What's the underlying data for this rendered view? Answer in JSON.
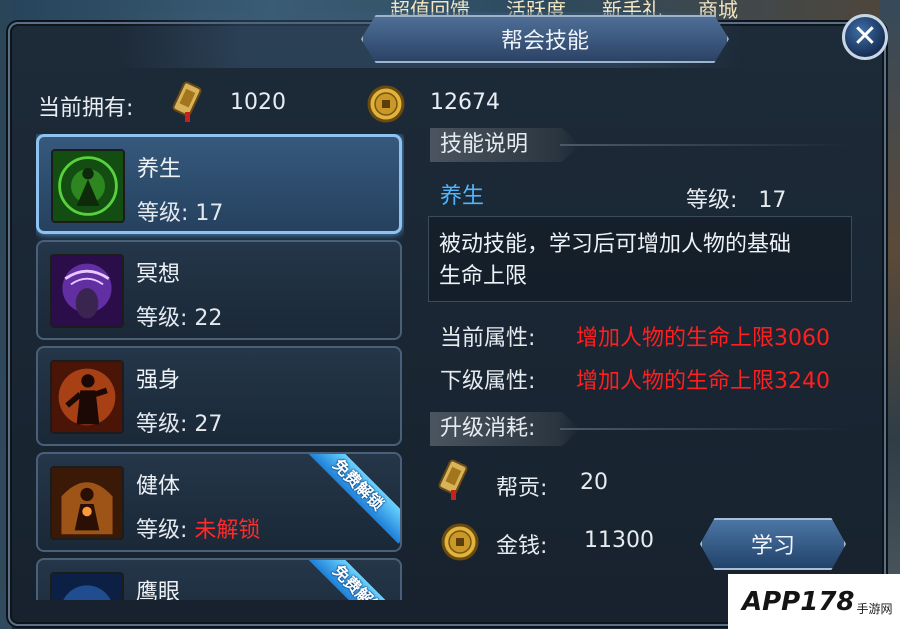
{
  "background": {
    "top_tabs": [
      "超值回馈",
      "活跃度",
      "新手礼",
      "商城"
    ]
  },
  "panel": {
    "title": "帮会技能",
    "close_icon": "close-icon"
  },
  "owned": {
    "label": "当前拥有:",
    "contribution": "1020",
    "gold": "12674"
  },
  "skills": [
    {
      "name": "养生",
      "level_label": "等级:",
      "level": "17",
      "locked": false,
      "selected": true,
      "ribbon": "",
      "icon": "meditation-icon",
      "color": "#3fae2a"
    },
    {
      "name": "冥想",
      "level_label": "等级:",
      "level": "22",
      "locked": false,
      "selected": false,
      "ribbon": "",
      "icon": "mind-icon",
      "color": "#7b3fc7"
    },
    {
      "name": "强身",
      "level_label": "等级:",
      "level": "27",
      "locked": false,
      "selected": false,
      "ribbon": "",
      "icon": "strength-icon",
      "color": "#d0531d"
    },
    {
      "name": "健体",
      "level_label": "等级:",
      "level": "未解锁",
      "locked": true,
      "selected": false,
      "ribbon": "免费解锁",
      "icon": "body-icon",
      "color": "#b8631a"
    },
    {
      "name": "鹰眼",
      "level_label": "",
      "level": "",
      "locked": true,
      "selected": false,
      "ribbon": "免费解锁",
      "icon": "eye-icon",
      "color": "#2a5fb0"
    }
  ],
  "details": {
    "desc_header": "技能说明",
    "skill_name": "养生",
    "level_label": "等级:",
    "level": "17",
    "description_line1": "被动技能，学习后可增加人物的基础",
    "description_line2": "生命上限",
    "current_attr_label": "当前属性:",
    "current_attr_value": "增加人物的生命上限3060",
    "next_attr_label": "下级属性:",
    "next_attr_value": "增加人物的生命上限3240"
  },
  "cost": {
    "header": "升级消耗:",
    "contribution_label": "帮贡:",
    "contribution_value": "20",
    "gold_label": "金钱:",
    "gold_value": "11300"
  },
  "learn_button": "学习",
  "watermark": {
    "main": "APP178",
    "sub": "手游网"
  }
}
